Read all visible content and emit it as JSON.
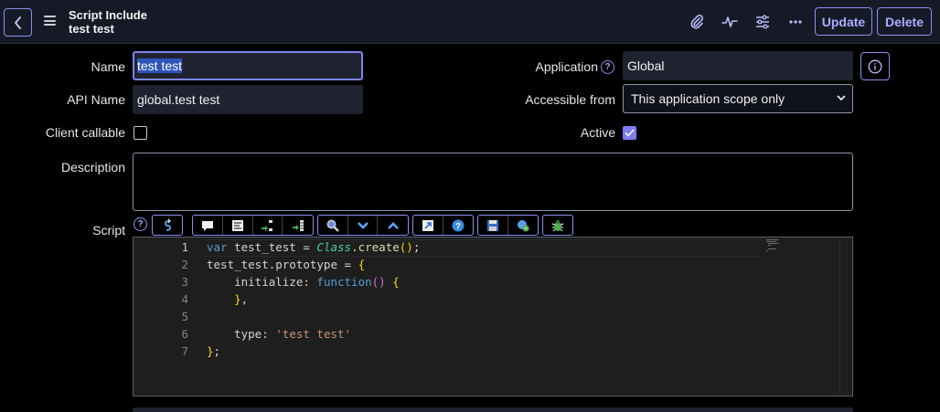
{
  "header": {
    "title": "Script Include",
    "subtitle": "test test",
    "update_label": "Update",
    "delete_label": "Delete",
    "icons": [
      "chevron-left-icon",
      "hamburger-icon",
      "paperclip-icon",
      "activity-icon",
      "sliders-icon",
      "more-icon"
    ]
  },
  "form": {
    "name_label": "Name",
    "name_value": "test test",
    "api_name_label": "API Name",
    "api_name_value": "global.test test",
    "client_callable_label": "Client callable",
    "client_callable_checked": false,
    "description_label": "Description",
    "description_value": "",
    "script_label": "Script",
    "application_label": "Application",
    "application_value": "Global",
    "accessible_from_label": "Accessible from",
    "accessible_from_value": "This application scope only",
    "active_label": "Active",
    "active_checked": true
  },
  "editor": {
    "line_numbers": [
      "1",
      "2",
      "3",
      "4",
      "5",
      "6",
      "7"
    ],
    "lines": [
      "var test_test = Class.create();",
      "test_test.prototype = {",
      "    initialize: function() {",
      "    },",
      "",
      "    type: 'test test'",
      "};"
    ]
  },
  "colors": {
    "accent": "#8b8ff0",
    "header_bg": "#161a26",
    "field_bg": "#1f2330",
    "checkbox_checked": "#7e7cf2"
  }
}
